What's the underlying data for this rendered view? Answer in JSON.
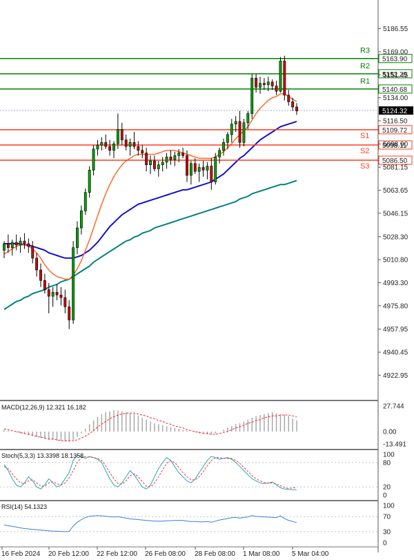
{
  "chart_data": {
    "type": "candlestick",
    "main": {
      "ylim": [
        4910,
        5200
      ],
      "y_ticks": [
        "5186.55",
        "5169.00",
        "5151.45",
        "5134.00",
        "5116.50",
        "5098.90",
        "5081.15",
        "5063.65",
        "5046.15",
        "5028.30",
        "5010.80",
        "4993.30",
        "4975.80",
        "4957.95",
        "4940.45",
        "4922.95"
      ],
      "current_price": "5124.32",
      "levels": [
        {
          "name": "R3",
          "value": 5163.9,
          "label": "5163.90",
          "color": "#008000",
          "kind": "resistance"
        },
        {
          "name": "R2",
          "value": 5152.29,
          "label": "5152.29",
          "color": "#008000",
          "kind": "resistance"
        },
        {
          "name": "R1",
          "value": 5140.68,
          "label": "5140.68",
          "color": "#008000",
          "kind": "resistance"
        },
        {
          "name": "S1",
          "value": 5109.72,
          "label": "5109.72",
          "color": "#ff3b1f",
          "kind": "support"
        },
        {
          "name": "S2",
          "value": 5098.11,
          "label": "5098.11",
          "color": "#ff3b1f",
          "kind": "support"
        },
        {
          "name": "S3",
          "value": 5086.5,
          "label": "5086.50",
          "color": "#ff3b1f",
          "kind": "support"
        }
      ],
      "candles": [
        [
          5018,
          5025,
          5012,
          5023
        ],
        [
          5023,
          5030,
          5016,
          5020
        ],
        [
          5020,
          5026,
          5014,
          5024
        ],
        [
          5024,
          5030,
          5018,
          5022
        ],
        [
          5022,
          5028,
          5016,
          5025
        ],
        [
          5025,
          5031,
          5019,
          5023
        ],
        [
          5023,
          5027,
          5016,
          5021
        ],
        [
          5021,
          5025,
          5008,
          5012
        ],
        [
          5012,
          5016,
          4998,
          5003
        ],
        [
          5003,
          5008,
          4990,
          4995
        ],
        [
          4995,
          5000,
          4985,
          4988
        ],
        [
          4988,
          4993,
          4970,
          4983
        ],
        [
          4983,
          4990,
          4975,
          4986
        ],
        [
          4986,
          4992,
          4980,
          4984
        ],
        [
          4984,
          4990,
          4976,
          4982
        ],
        [
          4982,
          4988,
          4970,
          4975
        ],
        [
          4975,
          4980,
          4958,
          4965
        ],
        [
          4965,
          5025,
          4962,
          5020
        ],
        [
          5020,
          5040,
          5015,
          5035
        ],
        [
          5035,
          5052,
          5030,
          5048
        ],
        [
          5048,
          5065,
          5045,
          5062
        ],
        [
          5062,
          5082,
          5058,
          5079
        ],
        [
          5079,
          5098,
          5075,
          5095
        ],
        [
          5095,
          5102,
          5090,
          5098
        ],
        [
          5098,
          5104,
          5094,
          5100
        ],
        [
          5100,
          5106,
          5095,
          5097
        ],
        [
          5097,
          5102,
          5090,
          5094
        ],
        [
          5094,
          5101,
          5088,
          5099
        ],
        [
          5099,
          5122,
          5095,
          5110
        ],
        [
          5110,
          5115,
          5098,
          5102
        ],
        [
          5102,
          5106,
          5094,
          5097
        ],
        [
          5097,
          5103,
          5090,
          5100
        ],
        [
          5100,
          5108,
          5095,
          5097
        ],
        [
          5097,
          5101,
          5090,
          5094
        ],
        [
          5094,
          5098,
          5088,
          5092
        ],
        [
          5092,
          5096,
          5078,
          5083
        ],
        [
          5083,
          5090,
          5076,
          5086
        ],
        [
          5086,
          5090,
          5078,
          5080
        ],
        [
          5080,
          5086,
          5074,
          5083
        ],
        [
          5083,
          5089,
          5078,
          5085
        ],
        [
          5085,
          5092,
          5080,
          5089
        ],
        [
          5089,
          5094,
          5083,
          5087
        ],
        [
          5087,
          5093,
          5082,
          5090
        ],
        [
          5090,
          5095,
          5085,
          5092
        ],
        [
          5092,
          5096,
          5088,
          5090
        ],
        [
          5090,
          5094,
          5070,
          5075
        ],
        [
          5075,
          5086,
          5068,
          5084
        ],
        [
          5084,
          5088,
          5076,
          5078
        ],
        [
          5078,
          5084,
          5070,
          5081
        ],
        [
          5081,
          5086,
          5074,
          5079
        ],
        [
          5079,
          5085,
          5072,
          5082
        ],
        [
          5082,
          5088,
          5064,
          5070
        ],
        [
          5070,
          5092,
          5068,
          5089
        ],
        [
          5089,
          5096,
          5084,
          5094
        ],
        [
          5094,
          5103,
          5090,
          5100
        ],
        [
          5100,
          5108,
          5095,
          5106
        ],
        [
          5106,
          5118,
          5100,
          5114
        ],
        [
          5114,
          5120,
          5108,
          5116
        ],
        [
          5116,
          5124,
          5096,
          5100
        ],
        [
          5100,
          5118,
          5097,
          5115
        ],
        [
          5115,
          5124,
          5110,
          5122
        ],
        [
          5122,
          5152,
          5118,
          5149
        ],
        [
          5149,
          5152,
          5138,
          5142
        ],
        [
          5142,
          5150,
          5137,
          5145
        ],
        [
          5145,
          5149,
          5140,
          5144
        ],
        [
          5144,
          5150,
          5139,
          5146
        ],
        [
          5146,
          5148,
          5140,
          5143
        ],
        [
          5143,
          5147,
          5136,
          5139
        ],
        [
          5139,
          5165,
          5138,
          5162
        ],
        [
          5162,
          5166,
          5132,
          5136
        ],
        [
          5136,
          5140,
          5128,
          5131
        ],
        [
          5131,
          5134,
          5124,
          5127
        ],
        [
          5127,
          5130,
          5121,
          5124
        ]
      ],
      "ma_fast": [
        5015,
        5017,
        5019,
        5021,
        5022,
        5022,
        5021,
        5019,
        5016,
        5012,
        5007,
        5003,
        5000,
        4998,
        4997,
        4996,
        4996,
        4999,
        5004,
        5010,
        5018,
        5026,
        5035,
        5044,
        5053,
        5061,
        5068,
        5074,
        5079,
        5083,
        5086,
        5088,
        5090,
        5091,
        5091,
        5091,
        5091,
        5091,
        5092,
        5093,
        5094,
        5094,
        5094,
        5093,
        5092,
        5091,
        5090,
        5089,
        5088,
        5088,
        5088,
        5088,
        5089,
        5091,
        5093,
        5096,
        5099,
        5103,
        5106,
        5109,
        5112,
        5117,
        5122,
        5126,
        5129,
        5132,
        5134,
        5135,
        5137,
        5137,
        5135,
        5133,
        5131
      ],
      "ma_mid": [
        5023,
        5023,
        5023,
        5023,
        5023,
        5022,
        5022,
        5021,
        5020,
        5019,
        5018,
        5016,
        5015,
        5014,
        5013,
        5012,
        5012,
        5012,
        5013,
        5014,
        5016,
        5018,
        5021,
        5024,
        5028,
        5032,
        5036,
        5039,
        5042,
        5045,
        5047,
        5049,
        5051,
        5053,
        5054,
        5055,
        5056,
        5057,
        5058,
        5059,
        5060,
        5061,
        5062,
        5063,
        5064,
        5064,
        5065,
        5066,
        5067,
        5068,
        5069,
        5070,
        5072,
        5074,
        5076,
        5079,
        5082,
        5085,
        5088,
        5090,
        5093,
        5096,
        5099,
        5102,
        5104,
        5106,
        5108,
        5110,
        5112,
        5113,
        5114,
        5115,
        5116
      ],
      "ma_slow": [
        4973,
        4975,
        4977,
        4979,
        4980,
        4982,
        4983,
        4985,
        4986,
        4987,
        4988,
        4990,
        4991,
        4992,
        4994,
        4995,
        4996,
        4998,
        5000,
        5002,
        5004,
        5006,
        5009,
        5011,
        5013,
        5015,
        5017,
        5019,
        5021,
        5023,
        5025,
        5026,
        5028,
        5029,
        5031,
        5032,
        5033,
        5035,
        5036,
        5037,
        5038,
        5039,
        5040,
        5041,
        5042,
        5043,
        5044,
        5045,
        5046,
        5047,
        5048,
        5049,
        5050,
        5051,
        5052,
        5053,
        5054,
        5055,
        5057,
        5058,
        5059,
        5061,
        5062,
        5063,
        5064,
        5065,
        5066,
        5067,
        5068,
        5068,
        5069,
        5070,
        5071
      ]
    },
    "macd": {
      "label": "MACD(12,26,9) 12.321 16.182",
      "y_ticks": [
        "27.744",
        "0.00",
        "-13.491"
      ],
      "ylim": [
        -13.491,
        27.744
      ],
      "hist": [
        2,
        1,
        0,
        -1,
        -2,
        -3,
        -4,
        -5,
        -6,
        -7,
        -8,
        -9,
        -9,
        -10,
        -10,
        -11,
        -11,
        -9,
        -6,
        -2,
        3,
        8,
        12,
        16,
        19,
        21,
        22,
        23,
        23,
        22,
        21,
        20,
        19,
        17,
        15,
        13,
        11,
        9,
        8,
        7,
        6,
        5,
        4,
        3,
        2,
        1,
        0,
        -1,
        -2,
        -2,
        -3,
        -3,
        -2,
        0,
        2,
        4,
        6,
        8,
        9,
        11,
        13,
        15,
        17,
        18,
        19,
        20,
        21,
        20,
        19,
        18,
        17,
        14,
        12
      ],
      "signal": [
        3,
        2,
        1,
        0,
        -1,
        -2,
        -3,
        -4,
        -5,
        -6,
        -7,
        -8,
        -8,
        -9,
        -10,
        -10,
        -10,
        -10,
        -9,
        -7,
        -5,
        -2,
        1,
        5,
        8,
        11,
        14,
        16,
        18,
        19,
        20,
        20,
        20,
        19,
        18,
        17,
        15,
        14,
        12,
        11,
        9,
        8,
        6,
        5,
        4,
        2,
        1,
        0,
        -1,
        -2,
        -2,
        -3,
        -3,
        -2,
        -1,
        0,
        2,
        4,
        5,
        7,
        9,
        10,
        12,
        13,
        15,
        16,
        17,
        17,
        18,
        18,
        18,
        17,
        16
      ]
    },
    "stoch": {
      "label": "Stoch(5,3,3) 13.3398 18.1358",
      "y_ticks": [
        "100",
        "80",
        "20",
        "0"
      ],
      "ylim": [
        0,
        100
      ],
      "k": [
        75,
        60,
        40,
        25,
        20,
        30,
        45,
        35,
        20,
        15,
        25,
        40,
        30,
        20,
        25,
        40,
        55,
        85,
        98,
        95,
        90,
        95,
        92,
        88,
        80,
        60,
        40,
        25,
        20,
        30,
        45,
        60,
        50,
        35,
        20,
        15,
        25,
        45,
        65,
        80,
        92,
        85,
        70,
        55,
        45,
        35,
        30,
        40,
        55,
        70,
        85,
        95,
        92,
        88,
        90,
        92,
        88,
        80,
        70,
        60,
        50,
        40,
        35,
        30,
        28,
        30,
        32,
        25,
        18,
        15,
        14,
        13,
        13
      ],
      "d": [
        70,
        65,
        52,
        40,
        30,
        28,
        35,
        38,
        30,
        22,
        22,
        30,
        33,
        28,
        25,
        30,
        42,
        60,
        80,
        92,
        94,
        93,
        92,
        90,
        85,
        72,
        55,
        40,
        28,
        27,
        35,
        48,
        52,
        45,
        33,
        22,
        20,
        30,
        45,
        62,
        78,
        85,
        80,
        68,
        55,
        45,
        38,
        37,
        45,
        58,
        72,
        85,
        92,
        92,
        90,
        90,
        90,
        85,
        78,
        68,
        58,
        48,
        40,
        35,
        31,
        29,
        30,
        28,
        23,
        19,
        16,
        18,
        18
      ]
    },
    "rsi": {
      "label": "RSI(14) 54.1323",
      "y_ticks": [
        "100",
        "70",
        "30",
        "0"
      ],
      "ylim": [
        0,
        100
      ],
      "values": [
        48,
        46,
        44,
        42,
        40,
        38,
        37,
        36,
        35,
        34,
        33,
        32,
        31,
        31,
        30,
        30,
        30,
        45,
        55,
        62,
        68,
        71,
        72,
        73,
        72,
        71,
        70,
        69,
        70,
        68,
        66,
        64,
        63,
        62,
        61,
        60,
        59,
        58,
        58,
        58,
        59,
        59,
        60,
        60,
        60,
        58,
        57,
        57,
        56,
        56,
        57,
        55,
        58,
        61,
        63,
        65,
        67,
        68,
        66,
        68,
        69,
        73,
        71,
        70,
        69,
        69,
        68,
        67,
        72,
        65,
        60,
        57,
        54
      ]
    },
    "x_labels": [
      "16 Feb 2024",
      "20 Feb 12:00",
      "22 Feb 12:00",
      "26 Feb 08:00",
      "28 Feb 08:00",
      "1 Mar 08:00",
      "5 Mar 04:00"
    ]
  },
  "colors": {
    "bull": "#00a000",
    "bear": "#cc0000",
    "candle_outline": "#000000",
    "ma_fast": "#ff6a2a",
    "ma_mid": "#1010cc",
    "ma_slow": "#008080",
    "macd_signal": "#ff2020",
    "macd_hist": "#a8a8a8",
    "stoch_k": "#2aa6b8",
    "stoch_d": "#e83a3a",
    "rsi": "#3a7fd8",
    "separator": "#777777",
    "current_price_bg": "#000000"
  }
}
